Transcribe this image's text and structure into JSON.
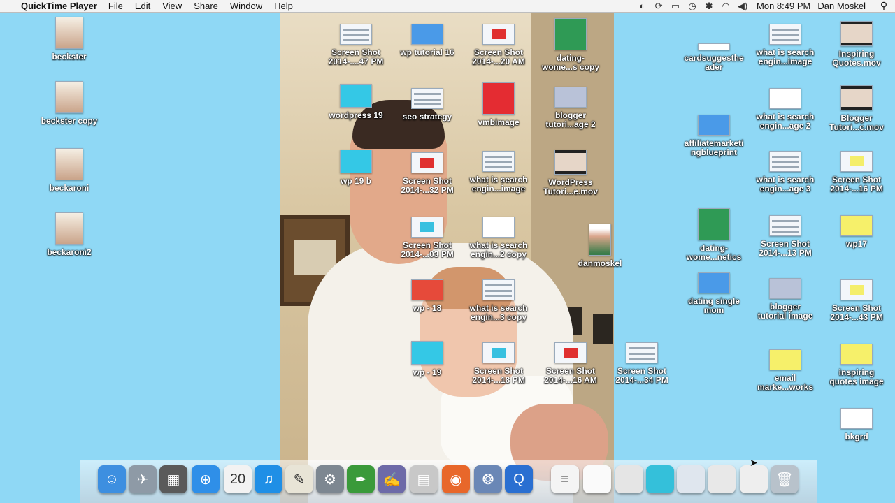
{
  "menubar": {
    "app_name": "QuickTime Player",
    "menus": [
      "File",
      "Edit",
      "View",
      "Share",
      "Window",
      "Help"
    ],
    "clock": "Mon 8:49 PM",
    "user": "Dan Moskel",
    "status_icons": [
      "evernote-icon",
      "sync-icon",
      "display-icon",
      "time-machine-icon",
      "bluetooth-icon",
      "wifi-icon",
      "volume-icon"
    ]
  },
  "desktop_icons": [
    {
      "name": "beckster",
      "label": "beckster",
      "kind": "photo"
    },
    {
      "name": "beckster-copy",
      "label": "beckster copy",
      "kind": "photo"
    },
    {
      "name": "beckaroni",
      "label": "beckaroni",
      "kind": "photo"
    },
    {
      "name": "beckaroni2",
      "label": "beckaroni2",
      "kind": "photo"
    },
    {
      "name": "screen-shot-47",
      "label": "Screen Shot\n2014-....47 PM",
      "kind": "screenshot"
    },
    {
      "name": "wp-tutorial-16",
      "label": "wp tutorial 16",
      "kind": "blue-doc"
    },
    {
      "name": "screen-shot-20",
      "label": "Screen Shot\n2014-...20 AM",
      "kind": "screenshot-red"
    },
    {
      "name": "dating-women-copy",
      "label": "dating-\nwome...s copy",
      "kind": "green"
    },
    {
      "name": "wordpress-19",
      "label": "wordpress 19",
      "kind": "cyan"
    },
    {
      "name": "seo-strategy",
      "label": "seo strategy",
      "kind": "screenshot"
    },
    {
      "name": "vmbimage",
      "label": "vmbimage",
      "kind": "red"
    },
    {
      "name": "blogger-tutorial-page-2",
      "label": "blogger\ntutori...age 2",
      "kind": "grey"
    },
    {
      "name": "wp-19-b",
      "label": "wp 19 b",
      "kind": "cyan"
    },
    {
      "name": "screen-shot-32",
      "label": "Screen Shot\n2014-...32 PM",
      "kind": "screenshot-red"
    },
    {
      "name": "what-is-search-image-a",
      "label": "what is search\nengin...image",
      "kind": "screenshot"
    },
    {
      "name": "wordpress-tutorial-mov",
      "label": "WordPress\nTutori...e.mov",
      "kind": "movie"
    },
    {
      "name": "screen-shot-03",
      "label": "Screen Shot\n2014-...03 PM",
      "kind": "screenshot-cyan"
    },
    {
      "name": "what-is-search-2-copy",
      "label": "what is search\nengin...2 copy",
      "kind": "white"
    },
    {
      "name": "danmoskel",
      "label": "danmoskel",
      "kind": "portrait"
    },
    {
      "name": "wp-18",
      "label": "wp - 18",
      "kind": "red-screenshot"
    },
    {
      "name": "what-is-search-3-copy",
      "label": "what is search\nengin...3 copy",
      "kind": "screenshot"
    },
    {
      "name": "wp-19",
      "label": "wp - 19",
      "kind": "cyan"
    },
    {
      "name": "screen-shot-18",
      "label": "Screen Shot\n2014-...18 PM",
      "kind": "screenshot-cyan"
    },
    {
      "name": "screen-shot-16-am",
      "label": "Screen Shot\n2014-...16 AM",
      "kind": "screenshot-red"
    },
    {
      "name": "screen-shot-34",
      "label": "Screen Shot\n2014-...34 PM",
      "kind": "screenshot"
    },
    {
      "name": "cardsuggestheader",
      "label": "cardsuggesthe\nader",
      "kind": "strip"
    },
    {
      "name": "affiliate-marketing-blueprint",
      "label": "affiliatemarketi\nngblueprint",
      "kind": "blue-doc"
    },
    {
      "name": "dating-women-netics",
      "label": "dating-\nwome...netics",
      "kind": "green"
    },
    {
      "name": "dating-single-mom",
      "label": "dating single\nmom",
      "kind": "blue-doc"
    },
    {
      "name": "what-is-search-image-b",
      "label": "what is search\nengin...image",
      "kind": "screenshot"
    },
    {
      "name": "what-is-search-page-2",
      "label": "what is search\nengin...age 2",
      "kind": "white"
    },
    {
      "name": "what-is-search-page-3",
      "label": "what is search\nengin...age 3",
      "kind": "screenshot"
    },
    {
      "name": "screen-shot-13",
      "label": "Screen Shot\n2014-...13 PM",
      "kind": "screenshot"
    },
    {
      "name": "blogger-tutorial-image",
      "label": "blogger\ntutorial image",
      "kind": "grey"
    },
    {
      "name": "email-marketing-works",
      "label": "email\nmarke...works",
      "kind": "yellow"
    },
    {
      "name": "inspiring-quotes-mov",
      "label": "Inspiring\nQuotes.mov",
      "kind": "movie"
    },
    {
      "name": "blogger-tutorial-mov",
      "label": "Blogger\nTutori...c.mov",
      "kind": "movie"
    },
    {
      "name": "screen-shot-16-pm",
      "label": "Screen Shot\n2014-...16 PM",
      "kind": "screenshot-yellow"
    },
    {
      "name": "wp17",
      "label": "wp17",
      "kind": "yellow"
    },
    {
      "name": "screen-shot-43",
      "label": "Screen Shot\n2014-...43 PM",
      "kind": "screenshot-yellow"
    },
    {
      "name": "inspiring-quotes-image",
      "label": "inspiring\nquotes image",
      "kind": "yellow"
    },
    {
      "name": "bkgrd",
      "label": "bkgrd",
      "kind": "white"
    }
  ],
  "dock": [
    {
      "name": "finder-icon",
      "glyph": "☺",
      "color": "#3d8fe0"
    },
    {
      "name": "launchpad-icon",
      "glyph": "✈",
      "color": "#8e9aa6"
    },
    {
      "name": "photo-booth-icon",
      "glyph": "▦",
      "color": "#5a5a5a"
    },
    {
      "name": "safari-icon",
      "glyph": "⊕",
      "color": "#2f8fe8"
    },
    {
      "name": "calendar-icon",
      "glyph": "20",
      "color": "#f2f2f2"
    },
    {
      "name": "itunes-icon",
      "glyph": "♫",
      "color": "#1f8fe6"
    },
    {
      "name": "textedit-icon",
      "glyph": "✎",
      "color": "#e8e4d6"
    },
    {
      "name": "system-preferences-icon",
      "glyph": "⚙",
      "color": "#7d8791"
    },
    {
      "name": "evernote-icon",
      "glyph": "✒",
      "color": "#3a9a3a"
    },
    {
      "name": "script-editor-icon",
      "glyph": "✍",
      "color": "#6d6aa8"
    },
    {
      "name": "calculator-icon",
      "glyph": "▤",
      "color": "#c8c8c8"
    },
    {
      "name": "firefox-icon",
      "glyph": "◉",
      "color": "#e8672a"
    },
    {
      "name": "iphoto-icon",
      "glyph": "❂",
      "color": "#6a87b6"
    },
    {
      "name": "quicktime-icon",
      "glyph": "Q",
      "color": "#2a6fd1"
    },
    {
      "name": "text-document-icon",
      "glyph": "≡",
      "color": "#f4f4f4"
    },
    {
      "name": "blank-document-icon",
      "glyph": "",
      "color": "#fafafa"
    },
    {
      "name": "stack-screenshot-1-icon",
      "glyph": "",
      "color": "#e5e5e5"
    },
    {
      "name": "stack-screenshot-2-icon",
      "glyph": "",
      "color": "#34c0da"
    },
    {
      "name": "stack-screenshot-3-icon",
      "glyph": "",
      "color": "#dfe6ee"
    },
    {
      "name": "stack-screenshot-4-icon",
      "glyph": "",
      "color": "#e8e8e8"
    },
    {
      "name": "stack-firefox-doc-icon",
      "glyph": "",
      "color": "#eeeeee"
    },
    {
      "name": "trash-icon",
      "glyph": "🗑",
      "color": "#b8c2cb"
    }
  ],
  "colors": {
    "desktop": "#8fd8f5",
    "label_text": "#ffffff"
  }
}
